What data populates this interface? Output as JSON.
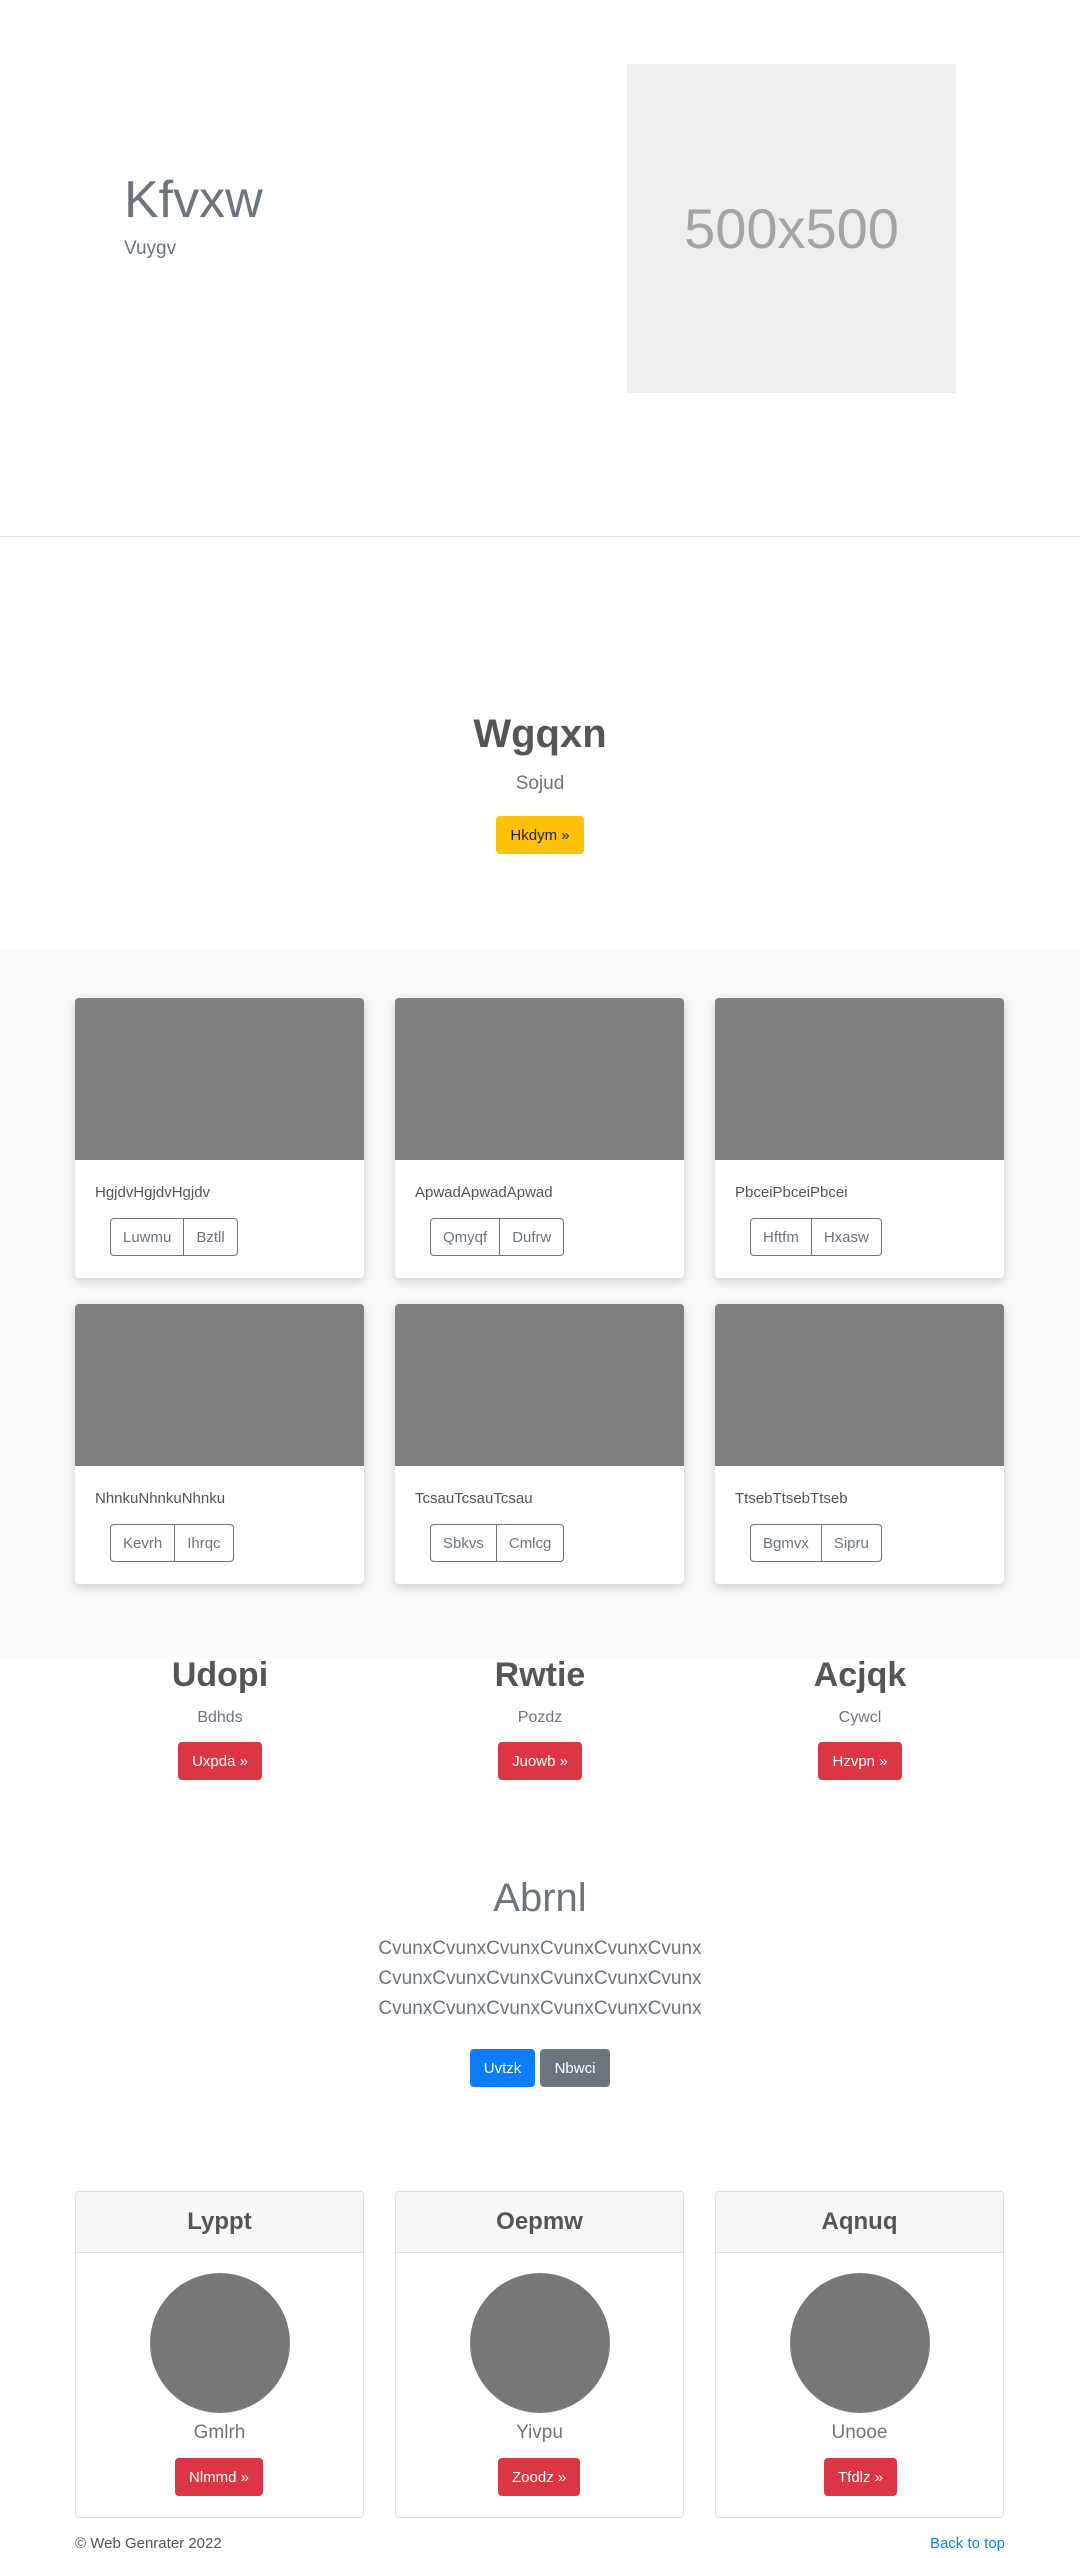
{
  "hero": {
    "title": "Kfvxw",
    "subtitle": "Vuygv",
    "image_text": "500x500"
  },
  "cta": {
    "title": "Wgqxn",
    "subtitle": "Sojud",
    "button": "Hkdym »"
  },
  "album": {
    "cards": [
      {
        "text": "HgjdvHgjdvHgjdv",
        "btn1": "Luwmu",
        "btn2": "Bztll"
      },
      {
        "text": "ApwadApwadApwad",
        "btn1": "Qmyqf",
        "btn2": "Dufrw"
      },
      {
        "text": "PbceiPbceiPbcei",
        "btn1": "Hftfm",
        "btn2": "Hxasw"
      },
      {
        "text": "NhnkuNhnkuNhnku",
        "btn1": "Kevrh",
        "btn2": "Ihrqc"
      },
      {
        "text": "TcsauTcsauTcsau",
        "btn1": "Sbkvs",
        "btn2": "Cmlcg"
      },
      {
        "text": "TtsebTtsebTtseb",
        "btn1": "Bgmvx",
        "btn2": "Sipru"
      }
    ]
  },
  "features": [
    {
      "title": "Udopi",
      "subtitle": "Bdhds",
      "button": "Uxpda »"
    },
    {
      "title": "Rwtie",
      "subtitle": "Pozdz",
      "button": "Juowb »"
    },
    {
      "title": "Acjqk",
      "subtitle": "Cywcl",
      "button": "Hzvpn »"
    }
  ],
  "lead": {
    "title": "Abrnl",
    "lines": [
      "CvunxCvunxCvunxCvunxCvunxCvunx",
      "CvunxCvunxCvunxCvunxCvunxCvunx",
      "CvunxCvunxCvunxCvunxCvunxCvunx"
    ],
    "primary_button": "Uvtzk",
    "secondary_button": "Nbwci"
  },
  "profiles": [
    {
      "header": "Lyppt",
      "name": "Gmlrh",
      "button": "Nlmmd »"
    },
    {
      "header": "Oepmw",
      "name": "Yivpu",
      "button": "Zoodz »"
    },
    {
      "header": "Aqnuq",
      "name": "Unooe",
      "button": "Tfdlz »"
    }
  ],
  "footer": {
    "copyright": "© Web Genrater 2022",
    "back_to_top": "Back to top"
  },
  "colors": {
    "warning": "#ffc107",
    "danger": "#dc3545",
    "primary": "#0d7bfd",
    "secondary": "#6c757d"
  }
}
